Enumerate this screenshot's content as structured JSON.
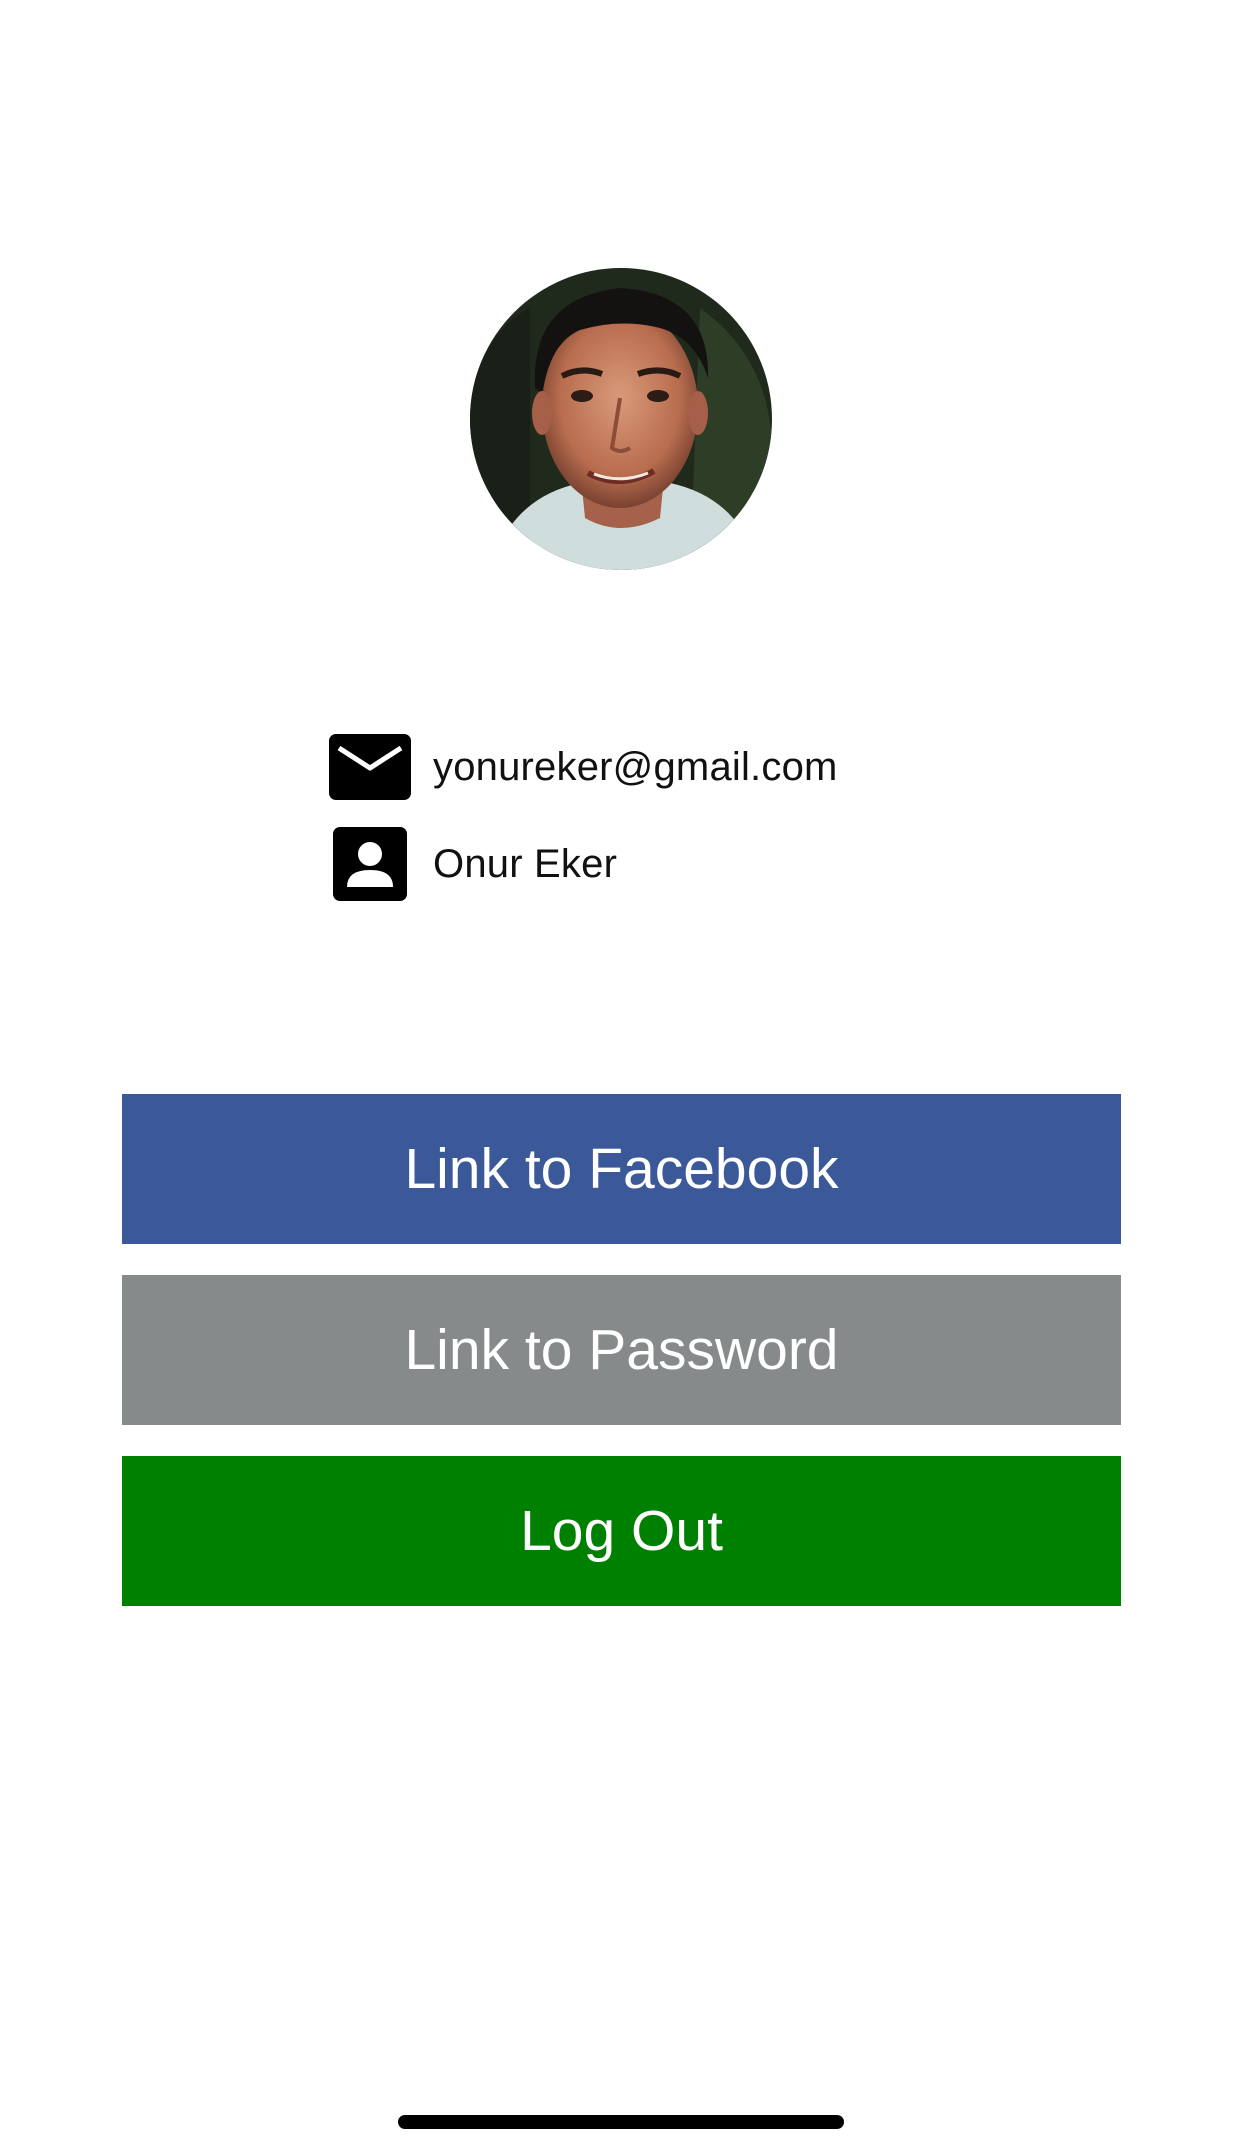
{
  "profile": {
    "avatar_alt": "profile photo",
    "email": "yonureker@gmail.com",
    "name": "Onur Eker"
  },
  "icons": {
    "email": "envelope-icon",
    "name": "contact-card-icon"
  },
  "buttons": {
    "facebook": {
      "label": "Link to Facebook",
      "color": "#3b5998"
    },
    "password": {
      "label": "Link to Password",
      "color": "#868a8a"
    },
    "logout": {
      "label": "Log Out",
      "color": "#008000"
    }
  }
}
